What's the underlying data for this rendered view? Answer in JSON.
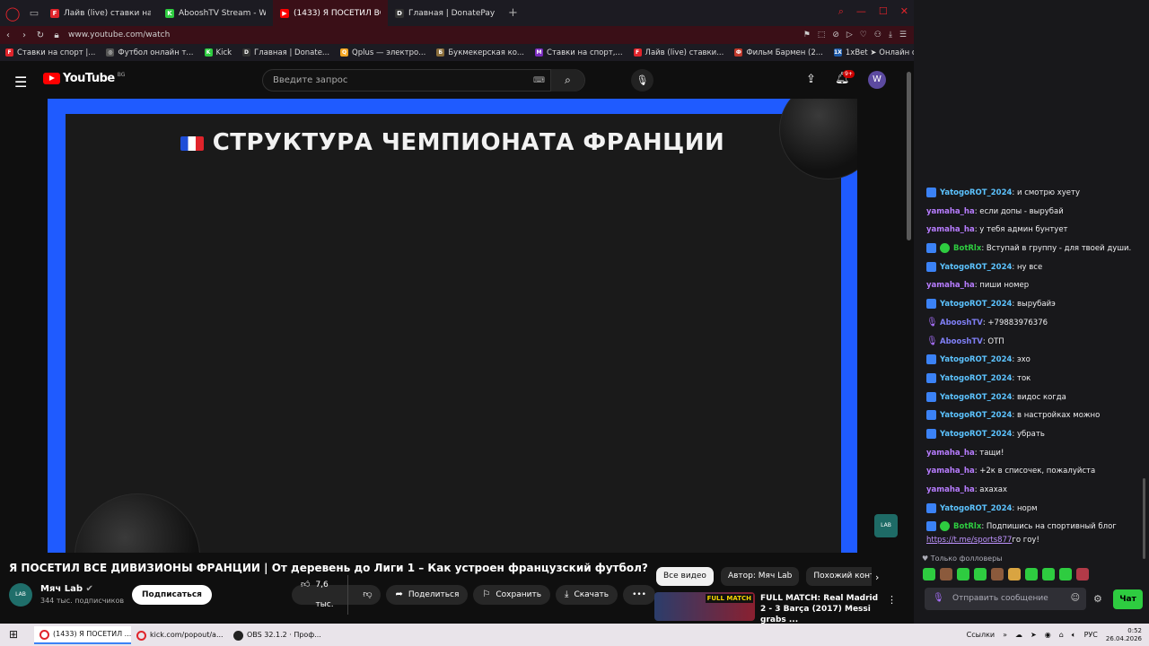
{
  "browser": {
    "tabs": [
      {
        "label": "Лайв (live) ставки на Киб",
        "fav_color": "#e0242b",
        "fav_text": "F"
      },
      {
        "label": "AbooshTV Stream - Watch",
        "fav_color": "#2ecc40",
        "fav_text": "K"
      },
      {
        "label": "(1433) Я ПОСЕТИЛ ВС",
        "fav_color": "#ff0000",
        "fav_text": "▶"
      },
      {
        "label": "Главная | DonatePay",
        "fav_color": "#333333",
        "fav_text": "D"
      }
    ],
    "url": "www.youtube.com/watch",
    "bookmarks": [
      {
        "label": "Ставки на спорт |...",
        "fav_color": "#e0242b",
        "fav_text": "F"
      },
      {
        "label": "Футбол онлайн т...",
        "fav_color": "#555555",
        "fav_text": "◎"
      },
      {
        "label": "Kick",
        "fav_color": "#2ecc40",
        "fav_text": "K"
      },
      {
        "label": "Главная | Donate...",
        "fav_color": "#333333",
        "fav_text": "D"
      },
      {
        "label": "Qplus — электро...",
        "fav_color": "#f5a623",
        "fav_text": "Q"
      },
      {
        "label": "Букмекерская ко...",
        "fav_color": "#8a6d3b",
        "fav_text": "Б"
      },
      {
        "label": "Ставки на спорт,...",
        "fav_color": "#7b2cbf",
        "fav_text": "M"
      },
      {
        "label": "Лайв (live) ставки...",
        "fav_color": "#e0242b",
        "fav_text": "F"
      },
      {
        "label": "Фильм Бармен (2...",
        "fav_color": "#c0392b",
        "fav_text": "Ф"
      },
      {
        "label": "1xBet ➤ Онлайн с...",
        "fav_color": "#1e5aa8",
        "fav_text": "1X"
      }
    ]
  },
  "youtube": {
    "logo_text": "YouTube",
    "logo_suffix": "BG",
    "search_placeholder": "Введите запрос",
    "notifications": "9+",
    "avatar_letter": "W",
    "video_slide_title": "СТРУКТУРА ЧЕМПИОНАТА ФРАНЦИИ",
    "video_title": "Я ПОСЕТИЛ ВСЕ ДИВИЗИОНЫ ФРАНЦИИ | От деревень до Лиги 1 – Как устроен французский футбол?",
    "channel": {
      "name": "Мяч Lab",
      "subs": "344 тыс. подписчиков",
      "avatar_text": "LAB",
      "subscribe": "Подписаться"
    },
    "actions": {
      "likes": "7,6 тыс.",
      "share": "Поделиться",
      "save": "Сохранить",
      "download": "Скачать"
    },
    "chips": [
      "Все видео",
      "Автор: Мяч Lab",
      "Похожий конте"
    ],
    "recommendation": {
      "title": "FULL MATCH: Real Madrid 2 - 3 Barça (2017) Messi grabs ...",
      "thumb_tag": "FULL MATCH"
    },
    "corner_logo": "LAB"
  },
  "chat": {
    "messages": [
      {
        "user": "YatogoROT_2024",
        "text": ": и смотрю хуету",
        "badges": [
          "s"
        ],
        "cls": "u-y"
      },
      {
        "user": "yamaha_ha",
        "text": ": если допы - вырубай",
        "badges": [],
        "cls": "u-h"
      },
      {
        "user": "yamaha_ha",
        "text": ": у тебя админ бунтует",
        "badges": [],
        "cls": "u-h"
      },
      {
        "user": "BotRlx",
        "text": ": Вступай в группу - для твоей души.",
        "badges": [
          "s",
          "g"
        ],
        "cls": "u-b"
      },
      {
        "user": "YatogoROT_2024",
        "text": ": ну все",
        "badges": [
          "s"
        ],
        "cls": "u-y"
      },
      {
        "user": "yamaha_ha",
        "text": ": пиши номер",
        "badges": [],
        "cls": "u-h"
      },
      {
        "user": "YatogoROT_2024",
        "text": ": вырубайэ",
        "badges": [
          "s"
        ],
        "cls": "u-y"
      },
      {
        "user": "AbooshTV",
        "text": ": +79883976376",
        "badges": [
          "m"
        ],
        "cls": "u-a"
      },
      {
        "user": "AbooshTV",
        "text": ": ОТП",
        "badges": [
          "m"
        ],
        "cls": "u-a"
      },
      {
        "user": "YatogoROT_2024",
        "text": ": эхо",
        "badges": [
          "s"
        ],
        "cls": "u-y"
      },
      {
        "user": "YatogoROT_2024",
        "text": ": ток",
        "badges": [
          "s"
        ],
        "cls": "u-y"
      },
      {
        "user": "YatogoROT_2024",
        "text": ": видос когда",
        "badges": [
          "s"
        ],
        "cls": "u-y"
      },
      {
        "user": "YatogoROT_2024",
        "text": ": в настройках можно",
        "badges": [
          "s"
        ],
        "cls": "u-y"
      },
      {
        "user": "YatogoROT_2024",
        "text": ": убрать",
        "badges": [
          "s"
        ],
        "cls": "u-y"
      },
      {
        "user": "yamaha_ha",
        "text": ": тащи!",
        "badges": [],
        "cls": "u-h"
      },
      {
        "user": "yamaha_ha",
        "text": ": +2к в списочек, пожалуйста",
        "badges": [],
        "cls": "u-h"
      },
      {
        "user": "yamaha_ha",
        "text": ": ахахах",
        "badges": [],
        "cls": "u-h"
      },
      {
        "user": "YatogoROT_2024",
        "text": ": норм",
        "badges": [
          "s"
        ],
        "cls": "u-y"
      },
      {
        "user": "BotRlx",
        "text": ": Подпишись на спортивный блог",
        "badges": [
          "s",
          "g"
        ],
        "cls": "u-b"
      }
    ],
    "last_link": "https://t.me/sports877",
    "last_link_tail": " го гоу!",
    "followers_only": "Только фолловеры",
    "input_placeholder": "Отправить сообщение",
    "send_label": "Чат"
  },
  "taskbar": {
    "apps": [
      {
        "label": "(1433) Я ПОСЕТИЛ ...",
        "kind": "opera",
        "active": true
      },
      {
        "label": "kick.com/popout/a...",
        "kind": "opera",
        "active": false
      },
      {
        "label": "OBS 32.1.2 · Проф...",
        "kind": "obs",
        "active": false
      }
    ],
    "links_label": "Ссылки",
    "lang": "РУС",
    "time": "0:52",
    "date": "26.04.2026"
  }
}
